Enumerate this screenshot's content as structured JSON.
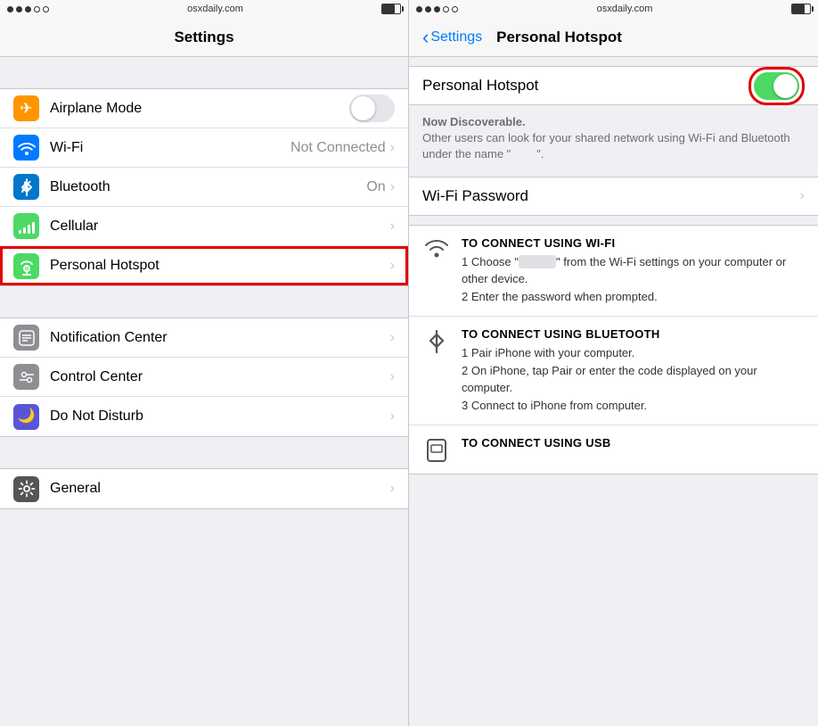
{
  "left": {
    "statusBar": {
      "dots": [
        true,
        true,
        true,
        false,
        false
      ],
      "url": "osxdaily.com",
      "battery": 70
    },
    "navTitle": "Settings",
    "section1": {
      "rows": [
        {
          "id": "airplane-mode",
          "icon": "airplane",
          "iconColor": "orange",
          "label": "Airplane Mode",
          "type": "toggle",
          "toggleOn": false
        },
        {
          "id": "wifi",
          "icon": "wifi",
          "iconColor": "blue",
          "label": "Wi-Fi",
          "value": "Not Connected",
          "type": "arrow"
        },
        {
          "id": "bluetooth",
          "icon": "bluetooth",
          "iconColor": "blue",
          "label": "Bluetooth",
          "value": "On",
          "type": "arrow"
        },
        {
          "id": "cellular",
          "icon": "cellular",
          "iconColor": "green",
          "label": "Cellular",
          "type": "arrow"
        },
        {
          "id": "personal-hotspot",
          "icon": "hotspot",
          "iconColor": "green",
          "label": "Personal Hotspot",
          "type": "arrow",
          "highlighted": true
        }
      ]
    },
    "section2": {
      "rows": [
        {
          "id": "notification-center",
          "icon": "notification",
          "iconColor": "gray",
          "label": "Notification Center",
          "type": "arrow"
        },
        {
          "id": "control-center",
          "icon": "control",
          "iconColor": "gray",
          "label": "Control Center",
          "type": "arrow"
        },
        {
          "id": "do-not-disturb",
          "icon": "moon",
          "iconColor": "purple",
          "label": "Do Not Disturb",
          "type": "arrow"
        }
      ]
    },
    "section3": {
      "rows": [
        {
          "id": "general",
          "icon": "gear",
          "iconColor": "dark-gray",
          "label": "General",
          "type": "arrow"
        }
      ]
    }
  },
  "right": {
    "statusBar": {
      "dots": [
        true,
        true,
        true,
        false,
        false
      ],
      "url": "osxdaily.com",
      "battery": 70
    },
    "navBackLabel": "Settings",
    "navTitle": "Personal Hotspot",
    "hotspotToggleLabel": "Personal Hotspot",
    "hotspotOn": true,
    "discoverableHeading": "Now Discoverable.",
    "discoverableBody": "Other users can look for your shared network using Wi-Fi and Bluetooth under the name “",
    "discoverableBodyEnd": "”.",
    "wifiPasswordLabel": "Wi-Fi Password",
    "connectSections": [
      {
        "id": "wifi-connect",
        "icon": "wifi",
        "heading": "TO CONNECT USING WI-FI",
        "steps": [
          "1 Choose “            ” from the Wi-Fi settings on your computer or other device.",
          "2 Enter the password when prompted."
        ]
      },
      {
        "id": "bluetooth-connect",
        "icon": "bluetooth",
        "heading": "TO CONNECT USING BLUETOOTH",
        "steps": [
          "1 Pair iPhone with your computer.",
          "2 On iPhone, tap Pair or enter the code displayed on your computer.",
          "3 Connect to iPhone from computer."
        ]
      },
      {
        "id": "usb-connect",
        "icon": "usb",
        "heading": "TO CONNECT USING USB",
        "steps": []
      }
    ]
  }
}
